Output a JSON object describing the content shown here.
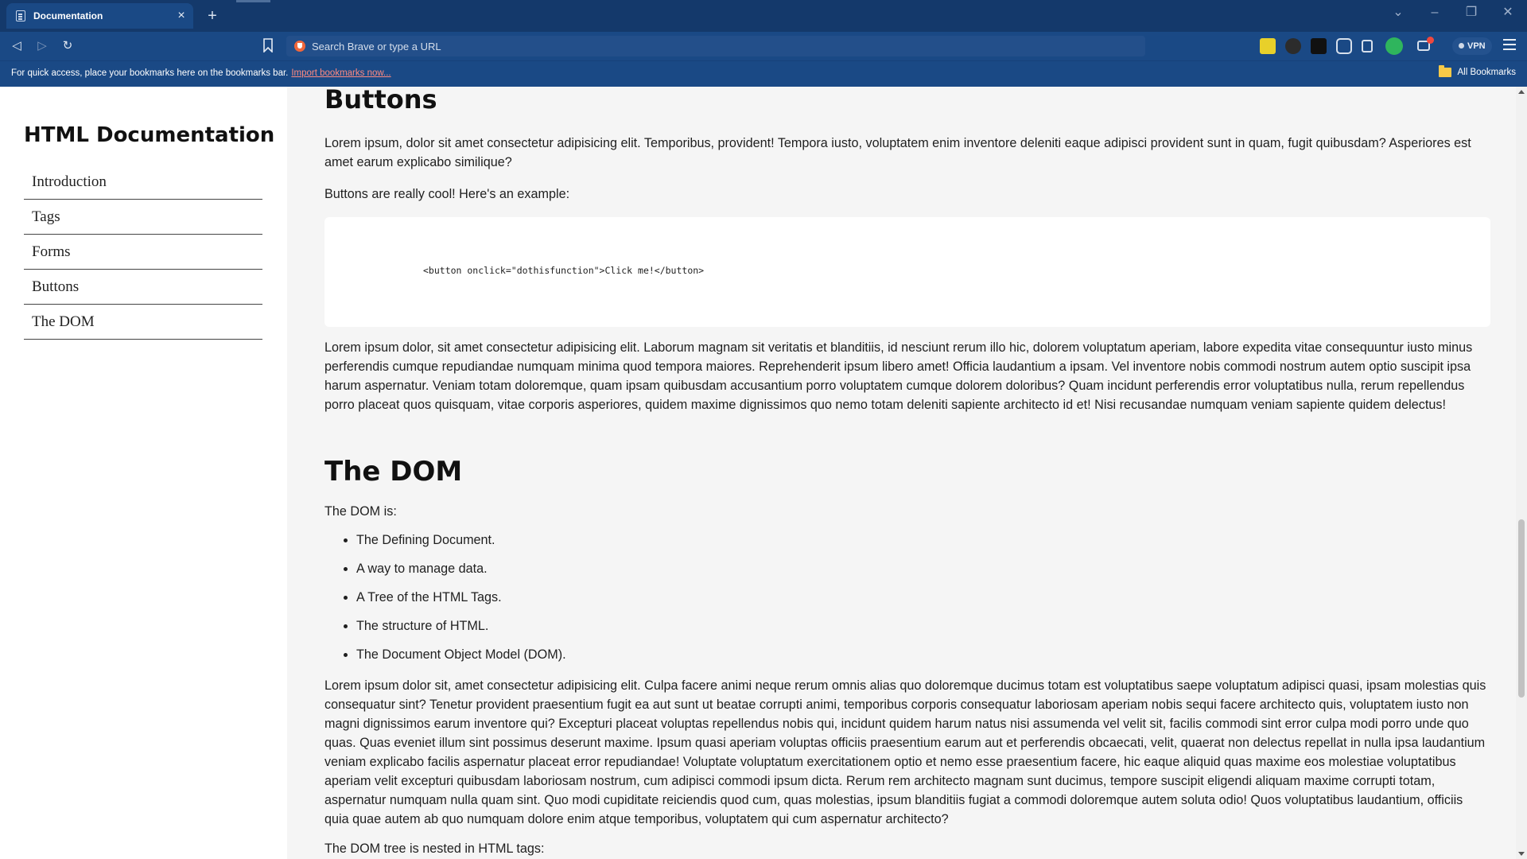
{
  "browser": {
    "tab_title": "Documentation",
    "new_tab_symbol": "+",
    "close_symbol": "×",
    "address_placeholder": "Search Brave or type a URL",
    "vpn_label": "VPN",
    "bookmarks_hint": "For quick access, place your bookmarks here on the bookmarks bar.",
    "import_link": "Import bookmarks now...",
    "all_bookmarks": "All Bookmarks",
    "accent_color": "#1a4985",
    "titlebar_color": "#14396b"
  },
  "sidebar": {
    "title": "HTML Documentation",
    "items": [
      {
        "label": "Introduction"
      },
      {
        "label": "Tags"
      },
      {
        "label": "Forms"
      },
      {
        "label": "Buttons"
      },
      {
        "label": "The DOM"
      }
    ]
  },
  "main": {
    "buttons_section": {
      "heading": "Buttons",
      "p1": "Lorem ipsum, dolor sit amet consectetur adipisicing elit. Temporibus, provident! Tempora iusto, voluptatem enim inventore deleniti eaque adipisci provident sunt in quam, fugit quibusdam? Asperiores est amet earum explicabo similique?",
      "p2": "Buttons are really cool! Here's an example:",
      "code": "<button onclick=\"dothisfunction\">Click me!</button>",
      "p3": "Lorem ipsum dolor, sit amet consectetur adipisicing elit. Laborum magnam sit veritatis et blanditiis, id nesciunt rerum illo hic, dolorem voluptatum aperiam, labore expedita vitae consequuntur iusto minus perferendis cumque repudiandae numquam minima quod tempora maiores. Reprehenderit ipsum libero amet! Officia laudantium a ipsam. Vel inventore nobis commodi nostrum autem optio suscipit ipsa harum aspernatur. Veniam totam doloremque, quam ipsam quibusdam accusantium porro voluptatem cumque dolorem doloribus? Quam incidunt perferendis error voluptatibus nulla, rerum repellendus porro placeat quos quisquam, vitae corporis asperiores, quidem maxime dignissimos quo nemo totam deleniti sapiente architecto id et! Nisi recusandae numquam veniam sapiente quidem delectus!"
    },
    "dom_section": {
      "heading": "The DOM",
      "intro": "The DOM is:",
      "list": [
        "The Defining Document.",
        "A way to manage data.",
        "A Tree of the HTML Tags.",
        "The structure of HTML.",
        "The Document Object Model (DOM)."
      ],
      "p1": "Lorem ipsum dolor sit, amet consectetur adipisicing elit. Culpa facere animi neque rerum omnis alias quo doloremque ducimus totam est voluptatibus saepe voluptatum adipisci quasi, ipsam molestias quis consequatur sint? Tenetur provident praesentium fugit ea aut sunt ut beatae corrupti animi, temporibus corporis consequatur laboriosam aperiam nobis sequi facere architecto quis, voluptatem iusto non magni dignissimos earum inventore qui? Excepturi placeat voluptas repellendus nobis qui, incidunt quidem harum natus nisi assumenda vel velit sit, facilis commodi sint error culpa modi porro unde quo quas. Quas eveniet illum sint possimus deserunt maxime. Ipsum quasi aperiam voluptas officiis praesentium earum aut et perferendis obcaecati, velit, quaerat non delectus repellat in nulla ipsa laudantium veniam explicabo facilis aspernatur placeat error repudiandae! Voluptate voluptatum exercitationem optio et nemo esse praesentium facere, hic eaque aliquid quas maxime eos molestiae voluptatibus aperiam velit excepturi quibusdam laboriosam nostrum, cum adipisci commodi ipsum dicta. Rerum rem architecto magnam sunt ducimus, tempore suscipit eligendi aliquam maxime corrupti totam, aspernatur numquam nulla quam sint. Quo modi cupiditate reiciendis quod cum, quas molestias, ipsum blanditiis fugiat a commodi doloremque autem soluta odio! Quos voluptatibus laudantium, officiis quia quae autem ab quo numquam dolore enim atque temporibus, voluptatem qui cum aspernatur architecto?",
      "p2": "The DOM tree is nested in HTML tags:"
    }
  }
}
